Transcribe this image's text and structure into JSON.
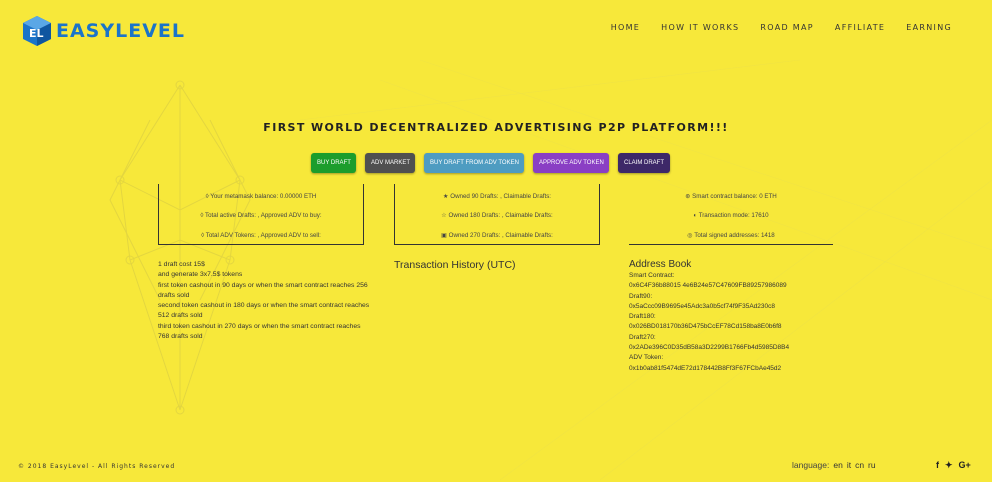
{
  "brand": {
    "name": "EASYLEVEL",
    "logo_letters": "EL"
  },
  "nav": [
    "HOME",
    "HOW IT WORKS",
    "ROAD MAP",
    "AFFILIATE",
    "EARNING"
  ],
  "headline": "FIRST WORLD DECENTRALIZED ADVERTISING P2P PLATFORM!!!",
  "actions": {
    "buy_draft": "BUY DRAFT",
    "adv_market": "ADV MARKET",
    "buy_from_adv": "BUY DRAFT FROM ADV TOKEN",
    "approve_adv": "APPROVE ADV TOKEN",
    "claim_draft": "CLAIM DRAFT"
  },
  "stats_left": {
    "balance": "◊ Your metamask balance: 0.00000 ETH",
    "active": "◊ Total active Drafts: , Approved ADV to buy:",
    "adv": "◊ Total ADV Tokens: , Approved ADV to sell:"
  },
  "stats_mid": {
    "d90": "★ Owned 90 Drafts: , Claimable Drafts:",
    "d180": "☆ Owned 180 Drafts: , Claimable Drafts:",
    "d270": "▣ Owned 270 Drafts: , Claimable Drafts:"
  },
  "stats_right": {
    "contract": "⊛ Smart contract balance: 0 ETH",
    "mode": "◐ Transaction mode: 17610",
    "signed": "◎ Total signed addresses: 1418"
  },
  "draft_info": [
    "1 draft cost 15$",
    "and generate 3x7.5$ tokens",
    "first token cashout in 90 days or when the smart contract reaches 256 drafts sold",
    "second token cashout in 180 days or when the smart contract reaches 512 drafts sold",
    "third token cashout in 270 days or when the smart contract reaches 768 drafts sold"
  ],
  "transaction_history_title": "Transaction History (UTC)",
  "address_book": {
    "title": "Address Book",
    "lines": [
      "Smart Contract:",
      "0x6C4F36b88015 4e6B24e57C47609FB89257986089",
      "Draft90:",
      "0x5aCcc09B9695e45Adc3a0b5cf74f9F35Ad230c8",
      "Draft180:",
      "0x026BD018170b36D475bCcEF78Cd158ba8E0b6f8",
      "Draft270:",
      "0x2ADe396C0D35dB58a3D2299B1766Fb4d5985D8B4",
      "ADV Token:",
      "0x1b0ab81f5474dE72d178442B8Ff3F67FCbAe45d2"
    ]
  },
  "footer": {
    "copyright": "© 2018 EasyLevel - All Rights Reserved",
    "language_label": "language:",
    "languages": [
      "en",
      "it",
      "cn",
      "ru"
    ],
    "social": [
      "f",
      "✦",
      "G+"
    ]
  }
}
